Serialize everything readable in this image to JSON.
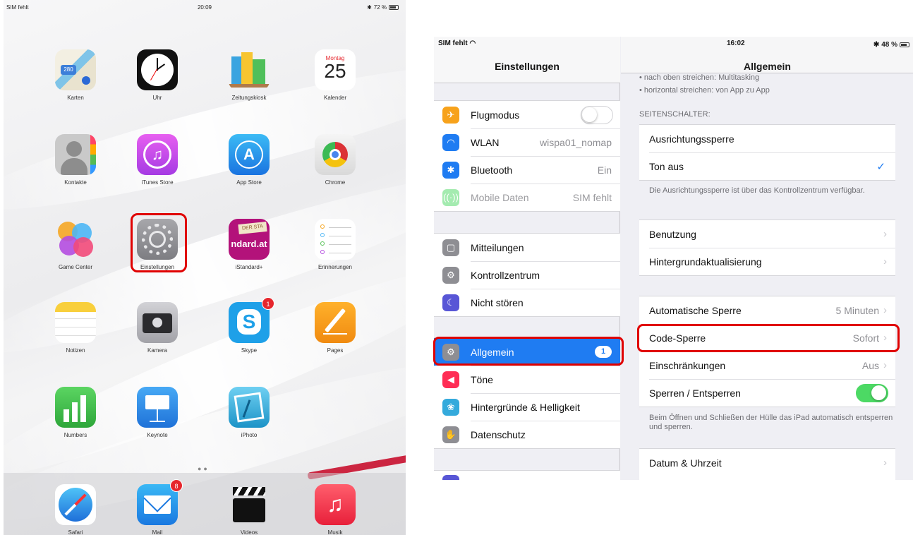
{
  "home": {
    "status": {
      "carrier": "SIM fehlt",
      "time": "20:09",
      "battery": "72 %"
    },
    "calendar": {
      "weekday": "Montag",
      "day": "25"
    },
    "apps": [
      {
        "label": "Karten",
        "badge": ""
      },
      {
        "label": "Uhr",
        "badge": ""
      },
      {
        "label": "Zeitungskiosk",
        "badge": ""
      },
      {
        "label": "Kalender",
        "badge": ""
      },
      {
        "label": "Kontakte",
        "badge": ""
      },
      {
        "label": "iTunes Store",
        "badge": ""
      },
      {
        "label": "App Store",
        "badge": ""
      },
      {
        "label": "Chrome",
        "badge": ""
      },
      {
        "label": "Game Center",
        "badge": ""
      },
      {
        "label": "Einstellungen",
        "badge": ""
      },
      {
        "label": "iStandard+",
        "badge": "",
        "icon_text": "ndard.at",
        "icon_top_text": "DER STA"
      },
      {
        "label": "Erinnerungen",
        "badge": ""
      },
      {
        "label": "Notizen",
        "badge": ""
      },
      {
        "label": "Kamera",
        "badge": ""
      },
      {
        "label": "Skype",
        "badge": "1"
      },
      {
        "label": "Pages",
        "badge": ""
      },
      {
        "label": "Numbers",
        "badge": ""
      },
      {
        "label": "Keynote",
        "badge": ""
      },
      {
        "label": "iPhoto",
        "badge": ""
      }
    ],
    "dock": [
      {
        "label": "Safari",
        "badge": ""
      },
      {
        "label": "Mail",
        "badge": "8"
      },
      {
        "label": "Videos",
        "badge": ""
      },
      {
        "label": "Musik",
        "badge": ""
      }
    ]
  },
  "settings": {
    "status": {
      "carrier": "SIM fehlt",
      "time": "16:02",
      "battery": "48 %"
    },
    "sidebar_title": "Einstellungen",
    "group1": [
      {
        "label": "Flugmodus",
        "value": "",
        "toggle": false
      },
      {
        "label": "WLAN",
        "value": "wispa01_nomap"
      },
      {
        "label": "Bluetooth",
        "value": "Ein"
      },
      {
        "label": "Mobile Daten",
        "value": "SIM fehlt"
      }
    ],
    "group2": [
      {
        "label": "Mitteilungen"
      },
      {
        "label": "Kontrollzentrum"
      },
      {
        "label": "Nicht stören"
      }
    ],
    "group3": [
      {
        "label": "Allgemein",
        "badge": "1",
        "selected": true
      },
      {
        "label": "Töne"
      },
      {
        "label": "Hintergründe & Helligkeit"
      },
      {
        "label": "Datenschutz"
      }
    ],
    "detail": {
      "title": "Allgemein",
      "top_lines": [
        "• nach oben streichen: Multitasking",
        "• horizontal streichen: von App zu App"
      ],
      "switch_header": "SEITENSCHALTER:",
      "switch_rows": [
        {
          "label": "Ausrichtungssperre"
        },
        {
          "label": "Ton aus",
          "checked": true
        }
      ],
      "switch_note": "Die Ausrichtungssperre ist über das Kontrollzentrum verfügbar.",
      "usage_rows": [
        {
          "label": "Benutzung"
        },
        {
          "label": "Hintergrundaktualisierung"
        }
      ],
      "lock_rows": [
        {
          "label": "Automatische Sperre",
          "value": "5 Minuten"
        },
        {
          "label": "Code-Sperre",
          "value": "Sofort"
        },
        {
          "label": "Einschränkungen",
          "value": "Aus"
        },
        {
          "label": "Sperren / Entsperren",
          "toggle": true
        }
      ],
      "lock_note": "Beim Öffnen und Schließen der Hülle das iPad automatisch entsperren und sperren.",
      "date_row": {
        "label": "Datum & Uhrzeit"
      }
    }
  }
}
